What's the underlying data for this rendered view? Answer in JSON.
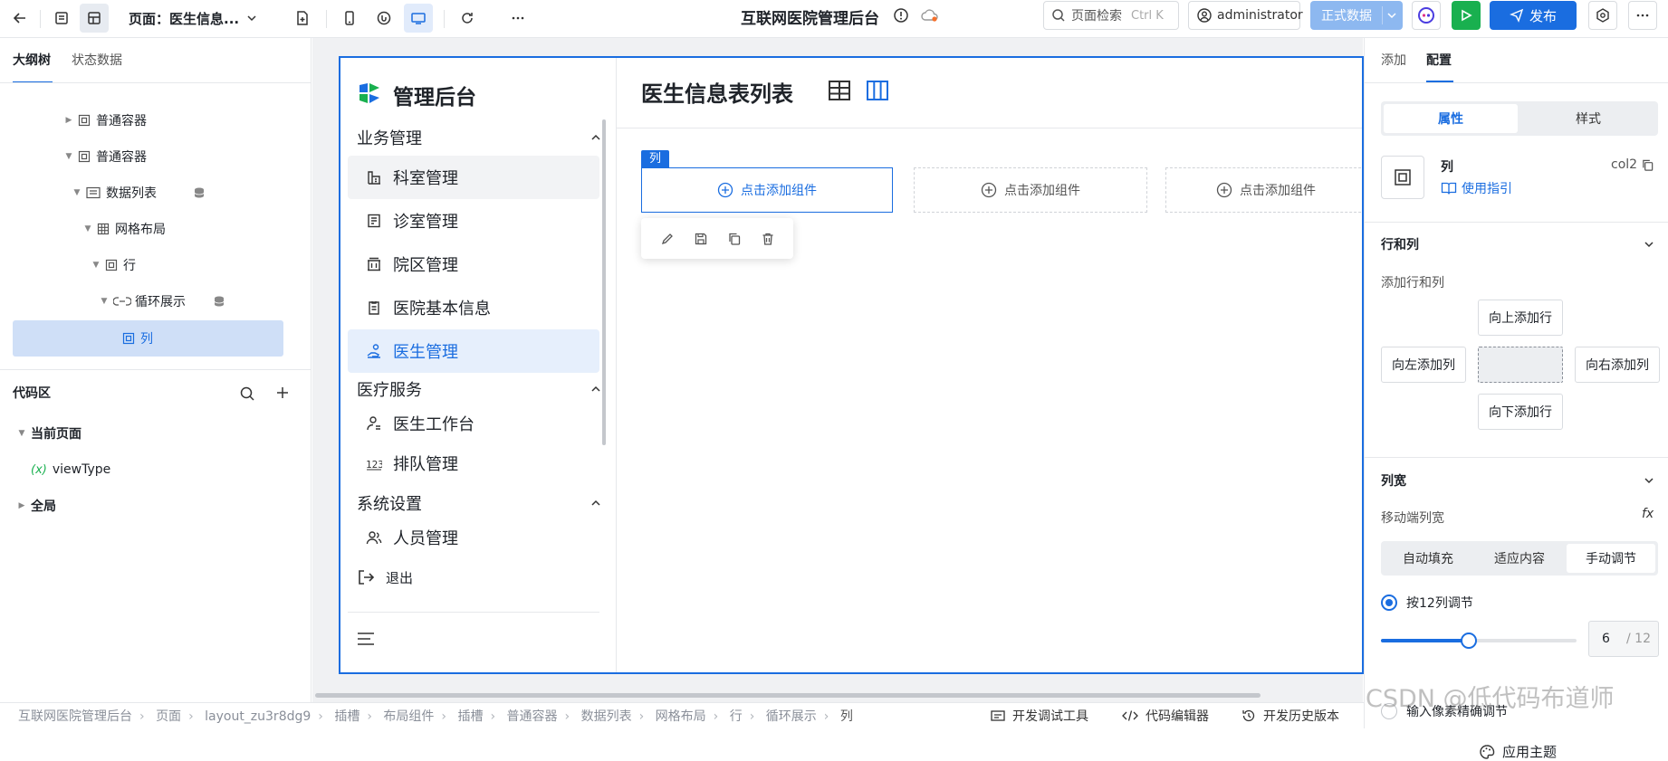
{
  "topbar": {
    "page_label": "页面：医生信息...",
    "app_title": "互联网医院管理后台",
    "search_placeholder": "页面检索",
    "search_shortcut": "Ctrl K",
    "user": "administrator",
    "env_label": "正式数据",
    "publish_label": "发布",
    "colors": {
      "accent": "#1a6de0",
      "run": "#19b04f",
      "env": "#8db8f0"
    }
  },
  "left_panel": {
    "tabs": [
      "大纲树",
      "状态数据"
    ],
    "tree": [
      {
        "label": "普通容器",
        "level": 1,
        "icon": "container-icon"
      },
      {
        "label": "普通容器",
        "level": 1,
        "icon": "container-icon"
      },
      {
        "label": "数据列表",
        "level": 2,
        "icon": "data-list-icon"
      },
      {
        "label": "网格布局",
        "level": 3,
        "icon": "grid-icon"
      },
      {
        "label": "行",
        "level": 4,
        "icon": "container-icon"
      },
      {
        "label": "循环展示",
        "level": 5,
        "icon": "loop-icon"
      },
      {
        "label": "列",
        "level": 6,
        "icon": "container-icon",
        "selected": true
      }
    ],
    "code_area": {
      "title": "代码区",
      "current_page": "当前页面",
      "variable": "viewType",
      "variable_prefix": "(x)",
      "global": "全局"
    }
  },
  "app": {
    "brand": "管理后台",
    "page_title": "医生信息表列表",
    "groups": [
      {
        "label": "业务管理",
        "items": [
          {
            "label": "科室管理",
            "icon": "department-icon"
          },
          {
            "label": "诊室管理",
            "icon": "room-icon"
          },
          {
            "label": "院区管理",
            "icon": "building-icon"
          },
          {
            "label": "医院基本信息",
            "icon": "document-icon"
          },
          {
            "label": "医生管理",
            "icon": "doctor-icon"
          }
        ]
      },
      {
        "label": "医疗服务",
        "items": [
          {
            "label": "医生工作台",
            "icon": "workbench-icon"
          },
          {
            "label": "排队管理",
            "icon": "queue-icon"
          }
        ]
      },
      {
        "label": "系统设置",
        "items": [
          {
            "label": "人员管理",
            "icon": "users-icon"
          }
        ]
      }
    ],
    "logout": "退出",
    "col_tag": "列",
    "add_component": "点击添加组件"
  },
  "right_panel": {
    "tabs": [
      "添加",
      "配置"
    ],
    "segment": [
      "属性",
      "样式"
    ],
    "component_name": "列",
    "component_id": "col2",
    "usage_guide": "使用指引",
    "rows_cols": {
      "title": "行和列",
      "subtitle": "添加行和列",
      "add_row_above": "向上添加行",
      "add_col_left": "向左添加列",
      "add_col_right": "向右添加列",
      "add_row_below": "向下添加行"
    },
    "col_width": {
      "title": "列宽",
      "mobile_label": "移动端列宽",
      "fx": "fx",
      "modes": [
        "自动填充",
        "适应内容",
        "手动调节"
      ],
      "radio_12": "按12列调节",
      "value": "6",
      "max": "/ 12",
      "radio_px": "输入像素精确调节"
    },
    "apply_theme": "应用主题"
  },
  "statusbar": {
    "breadcrumbs": [
      "互联网医院管理后台",
      "页面",
      "layout_zu3r8dg9",
      "插槽",
      "布局组件",
      "插槽",
      "普通容器",
      "数据列表",
      "网格布局",
      "行",
      "循环展示",
      "列"
    ],
    "dev_tools": "开发调试工具",
    "code_editor": "代码编辑器",
    "history": "开发历史版本"
  },
  "watermark": "CSDN @低代码布道师"
}
